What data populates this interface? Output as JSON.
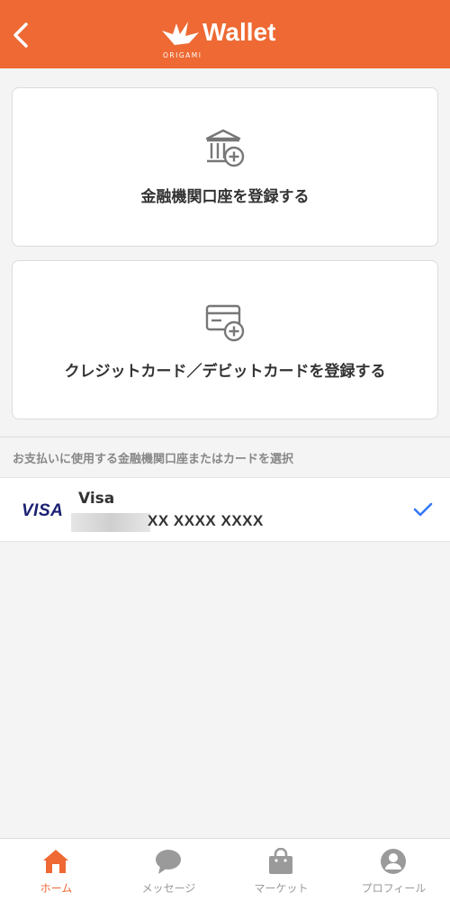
{
  "header": {
    "back_icon": "chevron-left-icon",
    "logo_subtitle": "ORIGAMI",
    "logo_title": "Wallet",
    "color": "#ee6933"
  },
  "register": {
    "bank_label": "金融機関口座を登録する",
    "bank_icon": "bank-add-icon",
    "card_label": "クレジットカード／デビットカードを登録する",
    "card_icon": "credit-card-add-icon"
  },
  "payment": {
    "section_label": "お支払いに使用する金融機関口座またはカードを選択",
    "selected_card": {
      "brand_logo": "VISA",
      "name": "Visa",
      "number": "XX XXXX XXXX",
      "selected": true
    }
  },
  "tabbar": {
    "items": [
      {
        "label": "ホーム",
        "icon": "home-icon",
        "active": true
      },
      {
        "label": "メッセージ",
        "icon": "message-icon",
        "active": false
      },
      {
        "label": "マーケット",
        "icon": "shopping-bag-icon",
        "active": false
      },
      {
        "label": "プロフィール",
        "icon": "profile-icon",
        "active": false
      }
    ],
    "active_color": "#ee6933",
    "inactive_color": "#999999"
  }
}
